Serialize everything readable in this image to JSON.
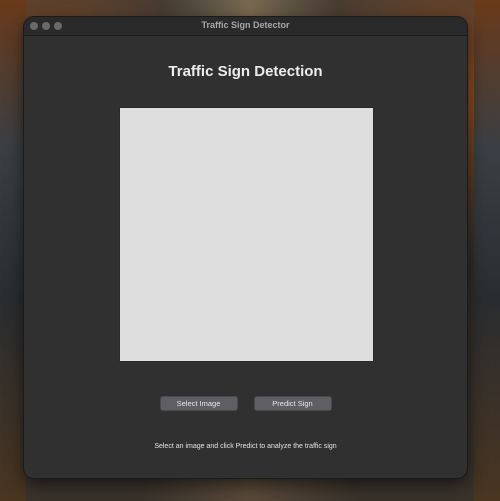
{
  "window": {
    "title": "Traffic Sign Detector"
  },
  "main": {
    "heading": "Traffic Sign Detection",
    "image_placeholder_color": "#dedede",
    "status_text": "Select an image and click Predict to analyze the traffic sign"
  },
  "buttons": {
    "select_label": "Select Image",
    "predict_label": "Predict Sign"
  },
  "colors": {
    "window_bg": "#303030",
    "button_bg": "#5e5e63",
    "text": "#ededed"
  }
}
